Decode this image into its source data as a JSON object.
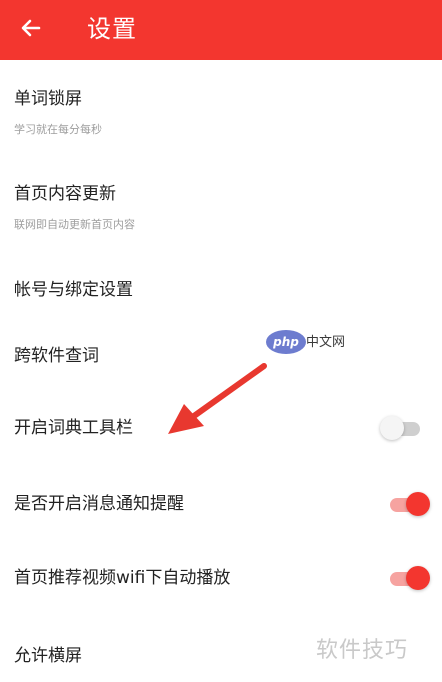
{
  "header": {
    "title": "设置",
    "back_icon": "arrow-left-icon",
    "background": "#f3362f"
  },
  "settings": [
    {
      "label": "单词锁屏",
      "subtitle": "学习就在每分每秒"
    },
    {
      "label": "首页内容更新",
      "subtitle": "联网即自动更新首页内容"
    },
    {
      "label": "帐号与绑定设置"
    },
    {
      "label": "跨软件查词"
    },
    {
      "label": "开启词典工具栏",
      "toggle": "off"
    },
    {
      "label": "是否开启消息通知提醒",
      "toggle": "on"
    },
    {
      "label": "首页推荐视频wifi下自动播放",
      "toggle": "on"
    },
    {
      "label": "允许横屏"
    }
  ],
  "watermarks": {
    "php_logo": "php",
    "php_text": "中文网",
    "site": "软件技巧"
  },
  "colors": {
    "accent": "#f3362f",
    "toggle_off": "#cfcfcf",
    "annotation_arrow": "#e8382f"
  }
}
